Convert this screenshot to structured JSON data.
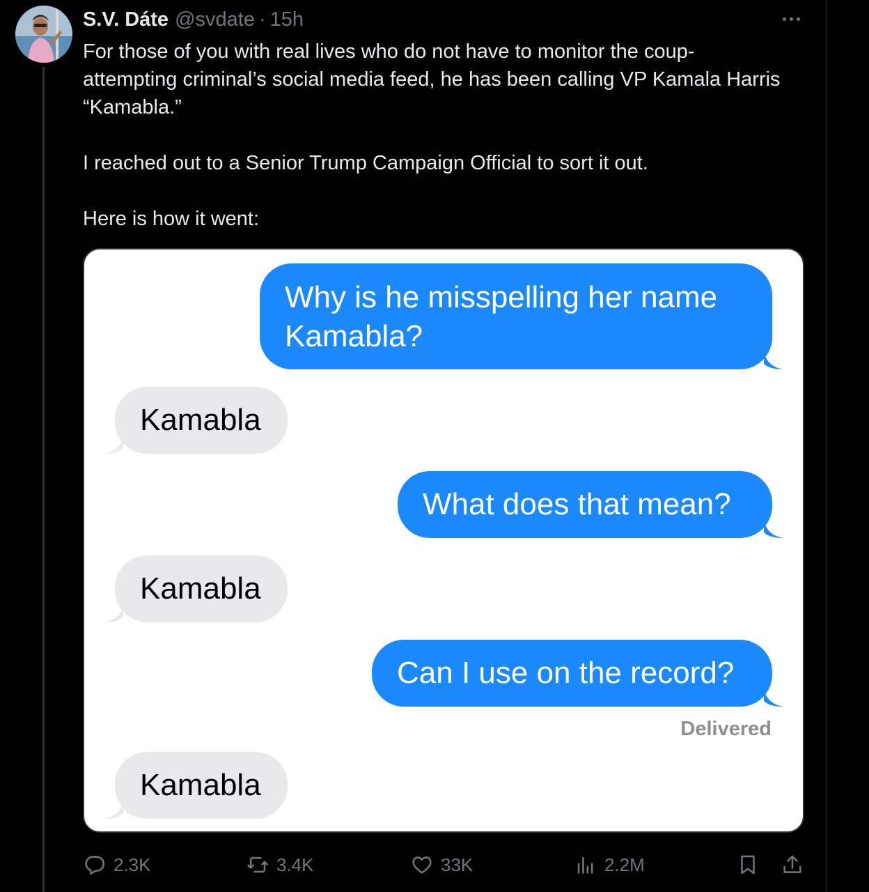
{
  "tweet": {
    "author_name": "S.V. Dáte",
    "handle": "@svdate",
    "separator": "·",
    "time": "15h",
    "paragraphs": [
      "For those of you with real lives who do not have to monitor the coup-attempting criminal’s social media feed, he has been calling VP Kamala Harris “Kamabla.”",
      "I reached out to a Senior Trump Campaign Official to sort it out.",
      "Here is how it went:"
    ],
    "more_icon": "more-horizontal-icon"
  },
  "conversation": {
    "messages": [
      {
        "direction": "sent",
        "lines": [
          "Why is he misspelling her name",
          "Kamabla?"
        ]
      },
      {
        "direction": "received",
        "text": "Kamabla"
      },
      {
        "direction": "sent",
        "text": "What does that mean?"
      },
      {
        "direction": "received",
        "text": "Kamabla"
      },
      {
        "direction": "sent",
        "text": "Can I use on the record?"
      },
      {
        "direction": "received",
        "text": "Kamabla"
      }
    ],
    "status": "Delivered",
    "colors": {
      "sent": "#1b89fb",
      "received": "#e9e9eb"
    }
  },
  "actions": {
    "replies": "2.3K",
    "reposts": "3.4K",
    "likes": "33K",
    "views": "2.2M",
    "icons": [
      "reply-icon",
      "repost-icon",
      "like-icon",
      "views-icon",
      "bookmark-icon",
      "share-icon"
    ]
  },
  "colors": {
    "background": "#000000",
    "text": "#e7e9ea",
    "muted": "#71767b",
    "border": "#2f3336"
  }
}
